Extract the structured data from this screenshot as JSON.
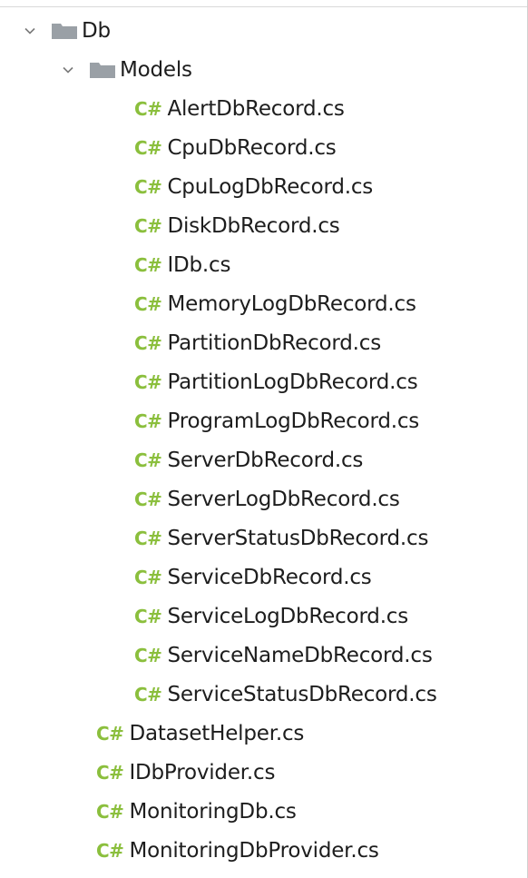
{
  "tree": {
    "root": {
      "label": "Db",
      "icon": "folder-icon",
      "expanded": true
    },
    "models": {
      "label": "Models",
      "icon": "folder-icon",
      "expanded": true
    },
    "file_badge": "C#",
    "model_files": [
      "AlertDbRecord.cs",
      "CpuDbRecord.cs",
      "CpuLogDbRecord.cs",
      "DiskDbRecord.cs",
      "IDb.cs",
      "MemoryLogDbRecord.cs",
      "PartitionDbRecord.cs",
      "PartitionLogDbRecord.cs",
      "ProgramLogDbRecord.cs",
      "ServerDbRecord.cs",
      "ServerLogDbRecord.cs",
      "ServerStatusDbRecord.cs",
      "ServiceDbRecord.cs",
      "ServiceLogDbRecord.cs",
      "ServiceNameDbRecord.cs",
      "ServiceStatusDbRecord.cs"
    ],
    "db_files": [
      "DatasetHelper.cs",
      "IDbProvider.cs",
      "MonitoringDb.cs",
      "MonitoringDbProvider.cs"
    ]
  },
  "colors": {
    "csharp_badge": "#8bbf3d",
    "folder": "#9aa0a6",
    "text": "#1d1d1d"
  }
}
